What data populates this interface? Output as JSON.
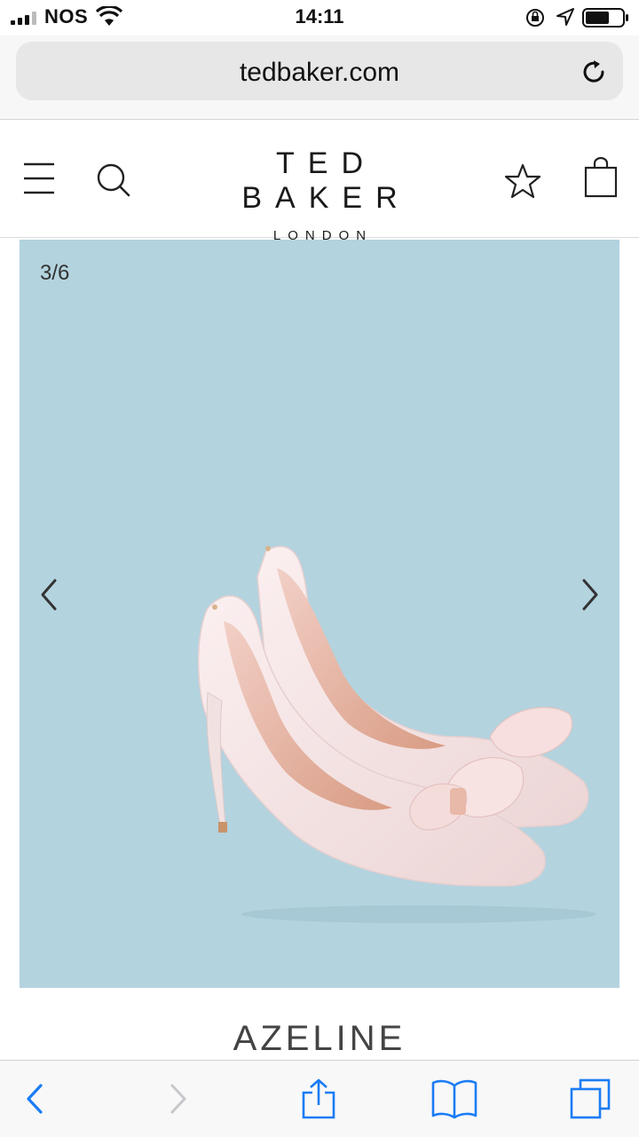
{
  "status_bar": {
    "carrier": "NOS",
    "time": "14:11",
    "icons": [
      "signal-icon",
      "wifi-icon",
      "rotation-lock-icon",
      "location-icon",
      "battery-icon"
    ]
  },
  "browser": {
    "url": "tedbaker.com",
    "icons": [
      "reload-icon"
    ]
  },
  "site_header": {
    "brand_name": "TED BAKER",
    "brand_sub": "LONDON",
    "icons": [
      "menu-icon",
      "search-icon",
      "wishlist-star-icon",
      "shopping-bag-icon"
    ]
  },
  "gallery": {
    "counter": "3/6",
    "background_color": "#b3d3df",
    "icons": [
      "chevron-left-icon",
      "chevron-right-icon"
    ]
  },
  "product": {
    "name": "AZELINE"
  },
  "toolbar": {
    "icons": [
      "back-icon",
      "forward-icon",
      "share-icon",
      "bookmarks-icon",
      "tabs-icon"
    ],
    "accent_color": "#1a7cf5"
  }
}
